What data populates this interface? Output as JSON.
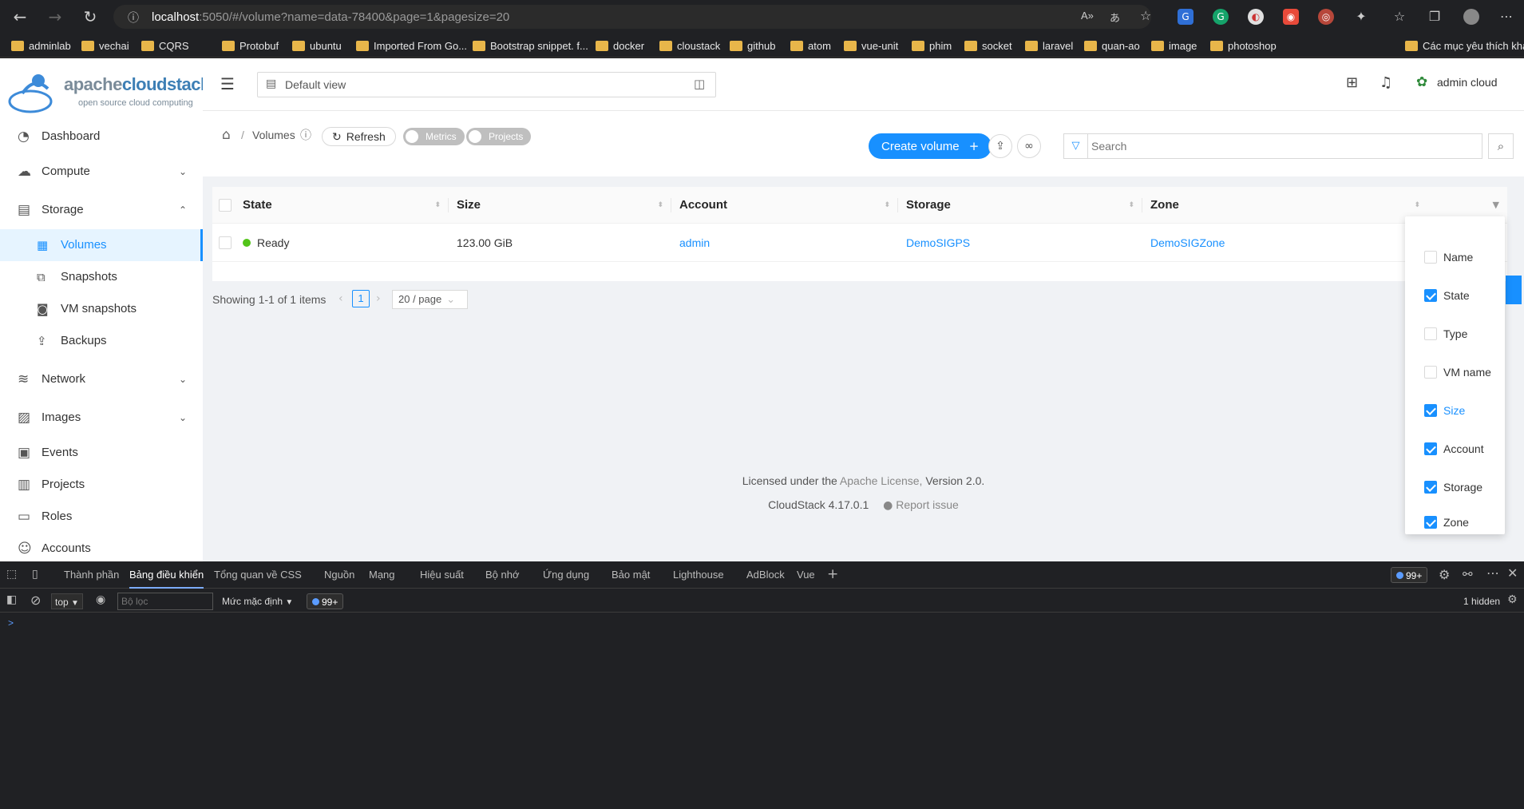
{
  "browser": {
    "url_host": "localhost",
    "url_rest": ":5050/#/volume?name=data-78400&page=1&pagesize=20",
    "bookmarks": [
      "adminlab",
      "vechai",
      "CQRS",
      "",
      "Protobuf",
      "ubuntu",
      "Imported From Go...",
      "Bootstrap snippet. f...",
      "docker",
      "cloustack",
      "github",
      "atom",
      "vue-unit",
      "phim",
      "socket",
      "laravel",
      "quan-ao",
      "image",
      "photoshop"
    ],
    "bookmarks_more": "Các mục yêu thích khác"
  },
  "logo": {
    "brand_prefix": "apache",
    "brand_main": "cloudstack",
    "tagline": "open source cloud computing"
  },
  "sidebar": {
    "items": [
      {
        "label": "Dashboard"
      },
      {
        "label": "Compute"
      },
      {
        "label": "Storage"
      },
      {
        "label": "Volumes"
      },
      {
        "label": "Snapshots"
      },
      {
        "label": "VM snapshots"
      },
      {
        "label": "Backups"
      },
      {
        "label": "Network"
      },
      {
        "label": "Images"
      },
      {
        "label": "Events"
      },
      {
        "label": "Projects"
      },
      {
        "label": "Roles"
      },
      {
        "label": "Accounts"
      }
    ]
  },
  "topbar": {
    "view": "Default view",
    "user": "admin cloud"
  },
  "toolbar": {
    "breadcrumb": "Volumes",
    "refresh": "Refresh",
    "metrics": "Metrics",
    "projects": "Projects",
    "create": "Create volume",
    "search_placeholder": "Search"
  },
  "table": {
    "columns": [
      "State",
      "Size",
      "Account",
      "Storage",
      "Zone"
    ],
    "rows": [
      {
        "state": "Ready",
        "size": "123.00 GiB",
        "account": "admin",
        "storage": "DemoSIGPS",
        "zone": "DemoSIGZone"
      }
    ]
  },
  "pager": {
    "summary": "Showing 1-1 of 1 items",
    "page": "1",
    "size": "20 / page"
  },
  "footer": {
    "license_prefix": "Licensed under the",
    "license_link": "Apache License,",
    "license_suffix": "Version 2.0.",
    "version": "CloudStack 4.17.0.1",
    "report": "Report issue"
  },
  "column_menu": [
    {
      "label": "Name",
      "checked": false
    },
    {
      "label": "State",
      "checked": true
    },
    {
      "label": "Type",
      "checked": false
    },
    {
      "label": "VM name",
      "checked": false
    },
    {
      "label": "Size",
      "checked": true
    },
    {
      "label": "Account",
      "checked": true
    },
    {
      "label": "Storage",
      "checked": true
    },
    {
      "label": "Zone",
      "checked": true
    }
  ],
  "devtools": {
    "tabs": [
      "Thành phần",
      "Bảng điều khiển",
      "Tổng quan về CSS",
      "Nguồn",
      "Mạng",
      "Hiệu suất",
      "Bộ nhớ",
      "Ứng dụng",
      "Bảo mật",
      "Lighthouse",
      "AdBlock",
      "Vue"
    ],
    "issues": "99+",
    "context": "top",
    "filter_placeholder": "Bộ lọc",
    "level": "Mức mặc định",
    "hidden": "1 hidden",
    "prompt": ">"
  },
  "colors": {
    "primary": "#1890ff",
    "success": "#52c41a"
  }
}
